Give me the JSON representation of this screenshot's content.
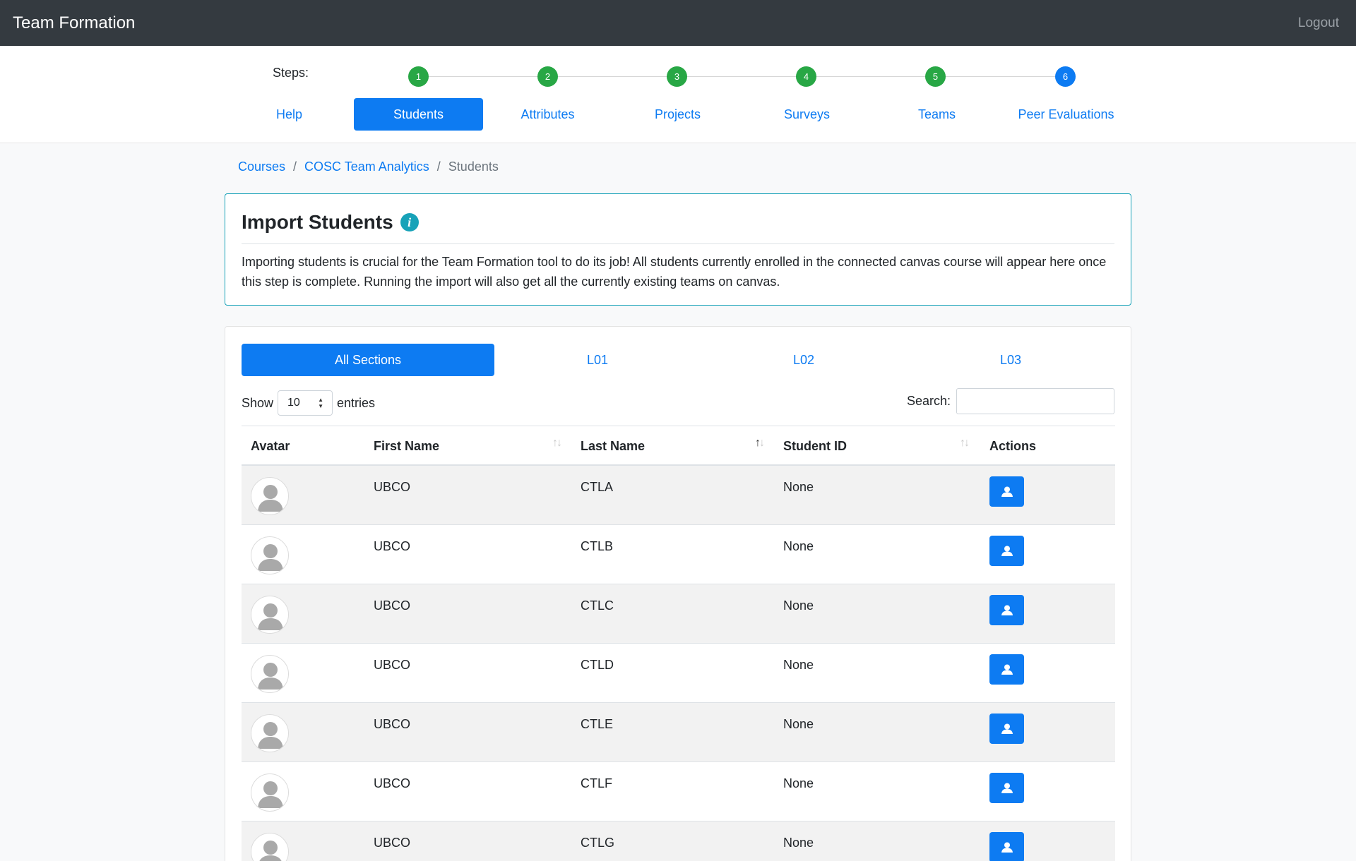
{
  "navbar": {
    "brand": "Team Formation",
    "logout_label": "Logout"
  },
  "steps": {
    "label": "Steps:",
    "items": [
      {
        "number": "1",
        "label": "Help"
      },
      {
        "number": "2",
        "label": "Students"
      },
      {
        "number": "3",
        "label": "Attributes"
      },
      {
        "number": "4",
        "label": "Projects"
      },
      {
        "number": "5",
        "label": "Surveys"
      },
      {
        "number": "6",
        "label": "Teams"
      }
    ],
    "last": {
      "number": "6",
      "label": "Peer Evaluations"
    }
  },
  "breadcrumb": {
    "courses": "Courses",
    "separator": "/",
    "course": "COSC Team Analytics",
    "current": "Students"
  },
  "info_card": {
    "title": "Import Students",
    "info_icon_glyph": "i",
    "text": "Importing students is crucial for the Team Formation tool to do its job! All students currently enrolled in the connected canvas course will appear here once this step is complete. Running the import will also get all the currently existing teams on canvas."
  },
  "sections": {
    "tabs": [
      "All Sections",
      "L01",
      "L02",
      "L03"
    ],
    "active": "All Sections"
  },
  "table_controls": {
    "show_label": "Show",
    "entries_value": "10",
    "entries_label": "entries",
    "search_label": "Search:",
    "search_value": ""
  },
  "table": {
    "columns": [
      "Avatar",
      "First Name",
      "Last Name",
      "Student ID",
      "Actions"
    ],
    "sort_arrows": "↑↓",
    "rows": [
      {
        "first": "UBCO",
        "last": "CTLA",
        "id": "None"
      },
      {
        "first": "UBCO",
        "last": "CTLB",
        "id": "None"
      },
      {
        "first": "UBCO",
        "last": "CTLC",
        "id": "None"
      },
      {
        "first": "UBCO",
        "last": "CTLD",
        "id": "None"
      },
      {
        "first": "UBCO",
        "last": "CTLE",
        "id": "None"
      },
      {
        "first": "UBCO",
        "last": "CTLF",
        "id": "None"
      },
      {
        "first": "UBCO",
        "last": "CTLG",
        "id": "None"
      }
    ]
  },
  "colors": {
    "navbar": "#343a40",
    "primary": "#0d7bf2",
    "step_complete": "#28a745",
    "info": "#17a2b8"
  },
  "icons": {
    "avatar": "user-silhouette-icon",
    "action": "user-profile-icon",
    "info": "info-icon",
    "sort": "sort-arrows-icon"
  }
}
